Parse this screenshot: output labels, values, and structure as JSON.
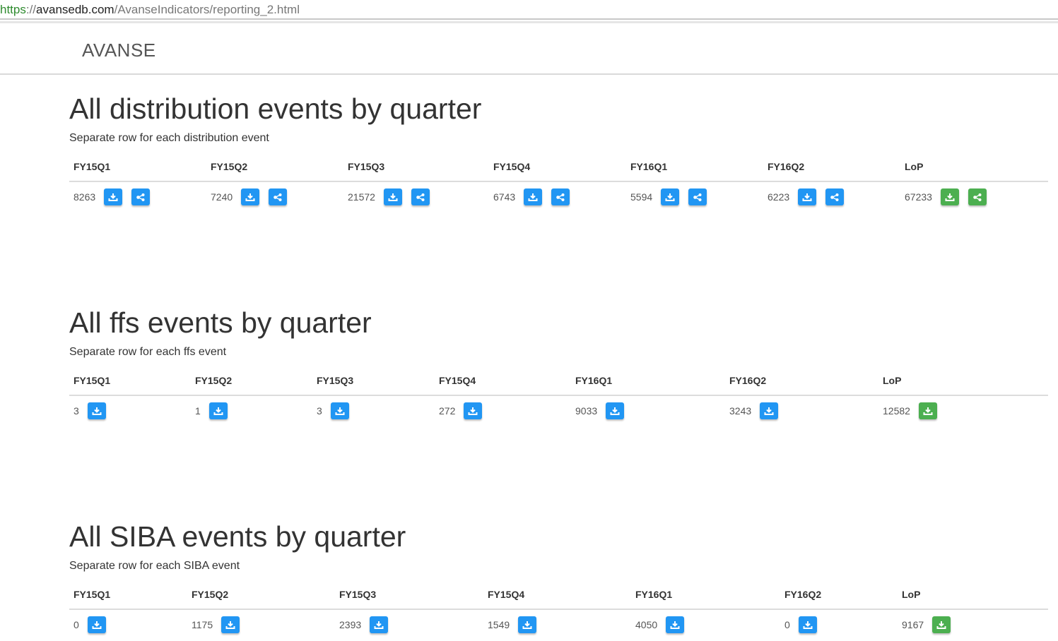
{
  "browser": {
    "url_scheme": "https",
    "url_sep": "://",
    "url_host": "avansedb.com",
    "url_path": "/AvanseIndicators/reporting_2.html"
  },
  "navbar": {
    "brand": "AVANSE"
  },
  "colors": {
    "blue_button": "#2196f3",
    "green_button": "#4caf50"
  },
  "icons": {
    "download": "download-icon",
    "share": "share-nodes-icon"
  },
  "sections": [
    {
      "title": "All distribution events by quarter",
      "subtitle": "Separate row for each distribution event",
      "headers": [
        "FY15Q1",
        "FY15Q2",
        "FY15Q3",
        "FY15Q4",
        "FY16Q1",
        "FY16Q2",
        "LoP"
      ],
      "values": [
        "8263",
        "7240",
        "21572",
        "6743",
        "5594",
        "6223",
        "67233"
      ],
      "has_share": true
    },
    {
      "title": "All ffs events by quarter",
      "subtitle": "Separate row for each ffs event",
      "headers": [
        "FY15Q1",
        "FY15Q2",
        "FY15Q3",
        "FY15Q4",
        "FY16Q1",
        "FY16Q2",
        "LoP"
      ],
      "values": [
        "3",
        "1",
        "3",
        "272",
        "9033",
        "3243",
        "12582"
      ],
      "has_share": false
    },
    {
      "title": "All SIBA events by quarter",
      "subtitle": "Separate row for each SIBA event",
      "headers": [
        "FY15Q1",
        "FY15Q2",
        "FY15Q3",
        "FY15Q4",
        "FY16Q1",
        "FY16Q2",
        "LoP"
      ],
      "values": [
        "0",
        "1175",
        "2393",
        "1549",
        "4050",
        "0",
        "9167"
      ],
      "has_share": false
    }
  ]
}
